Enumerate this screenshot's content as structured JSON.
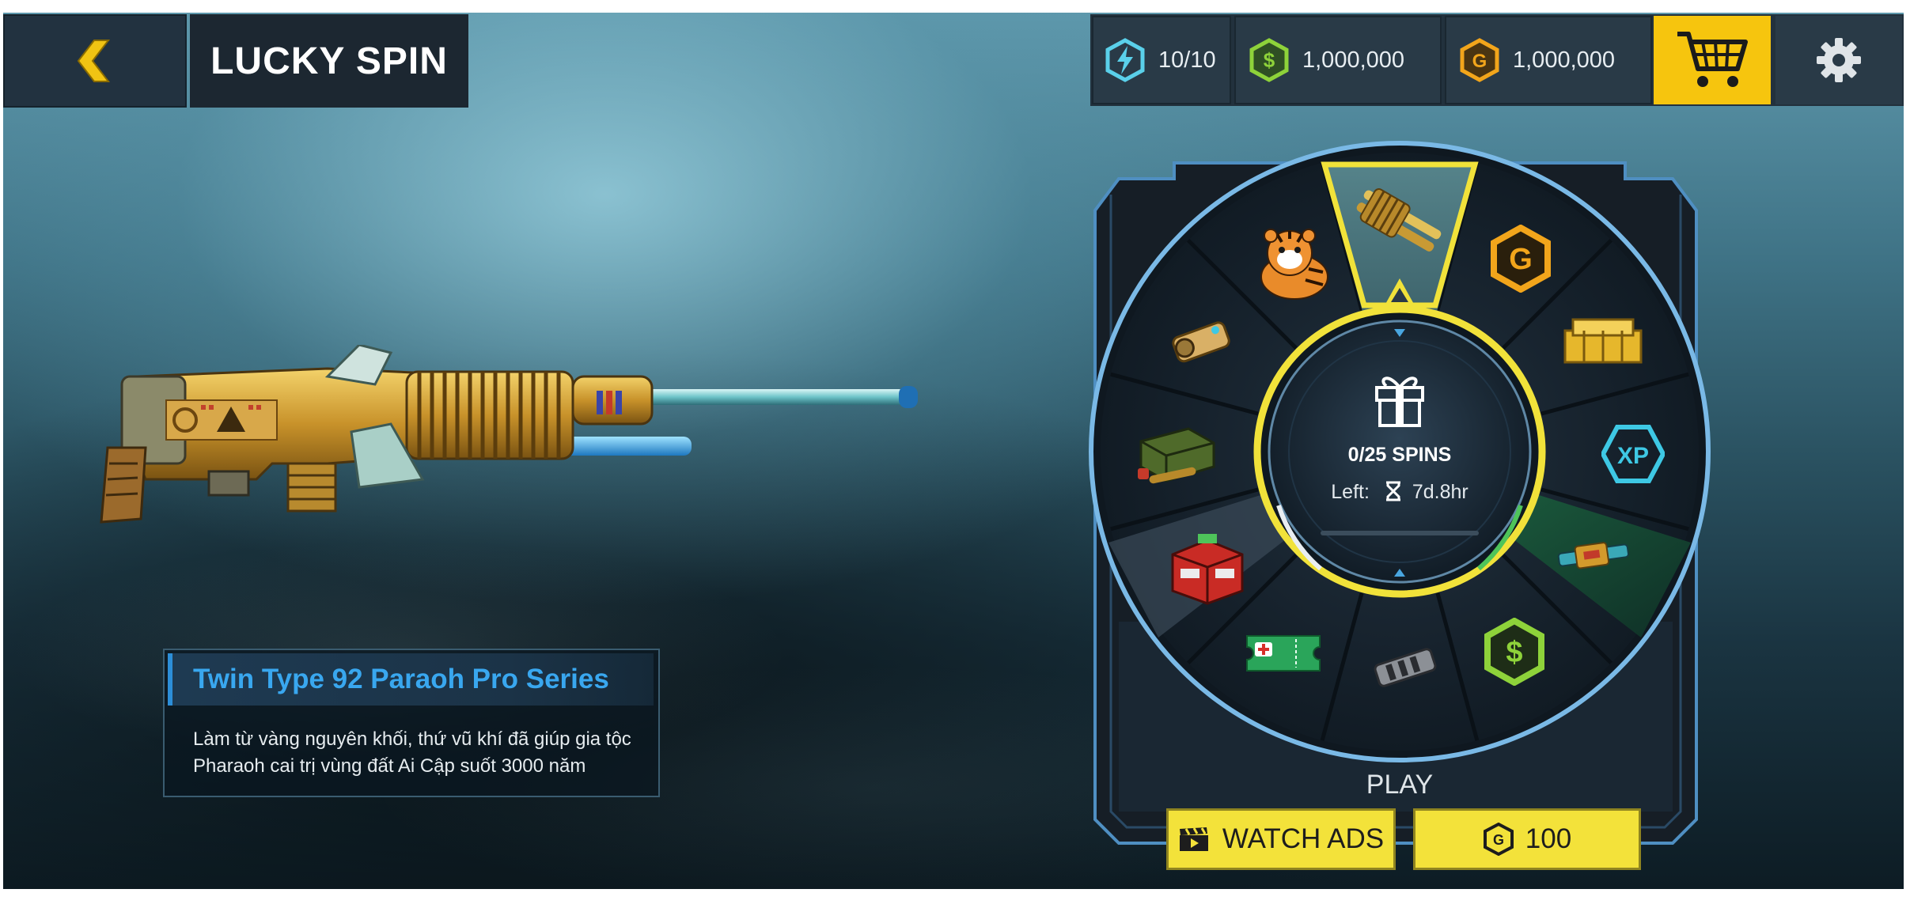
{
  "header": {
    "title": "LUCKY SPIN",
    "back_icon": "chevron-left-icon"
  },
  "resources": {
    "energy": {
      "icon": "lightning-icon",
      "value": "10/10"
    },
    "silver": {
      "icon": "silver-coin-icon",
      "value": "1,000,000"
    },
    "gold": {
      "icon": "gold-coin-icon",
      "value": "1,000,000"
    },
    "cart_icon": "cart-icon",
    "settings_icon": "gear-icon"
  },
  "item": {
    "name": "Twin Type 92 Paraoh Pro Series",
    "description": "Làm từ vàng nguyên khối, thứ vũ khí đã giúp gia tộc Pharaoh cai trị vùng đất Ai Cập suốt 3000 năm"
  },
  "wheel": {
    "segments": [
      {
        "name": "golden-twin-gun-icon",
        "selected": true
      },
      {
        "name": "gold-coin-reward-icon"
      },
      {
        "name": "gold-crates-icon"
      },
      {
        "name": "xp-badge-icon"
      },
      {
        "name": "weapon-skin-icon"
      },
      {
        "name": "silver-coin-reward-icon"
      },
      {
        "name": "muzzle-brake-icon"
      },
      {
        "name": "repair-kit-ticket-icon"
      },
      {
        "name": "red-supply-box-icon"
      },
      {
        "name": "ammo-box-icon"
      },
      {
        "name": "scope-attachment-icon"
      },
      {
        "name": "tiger-pet-icon"
      }
    ],
    "center": {
      "icon": "gift-icon",
      "spins": "0/25 SPINS",
      "left_label": "Left:",
      "timer_icon": "hourglass-icon",
      "time_left": "7d.8hr"
    }
  },
  "play": {
    "label": "PLAY",
    "watch_ads": {
      "icon": "clapperboard-icon",
      "label": "WATCH ADS"
    },
    "spin_cost": {
      "icon": "gold-coin-icon",
      "label": "100"
    }
  },
  "colors": {
    "accent_yellow": "#f3e23a",
    "cart_yellow": "#f6c50e",
    "title_blue": "#39a7ef",
    "wheel_ring": "#6fb2e0"
  }
}
